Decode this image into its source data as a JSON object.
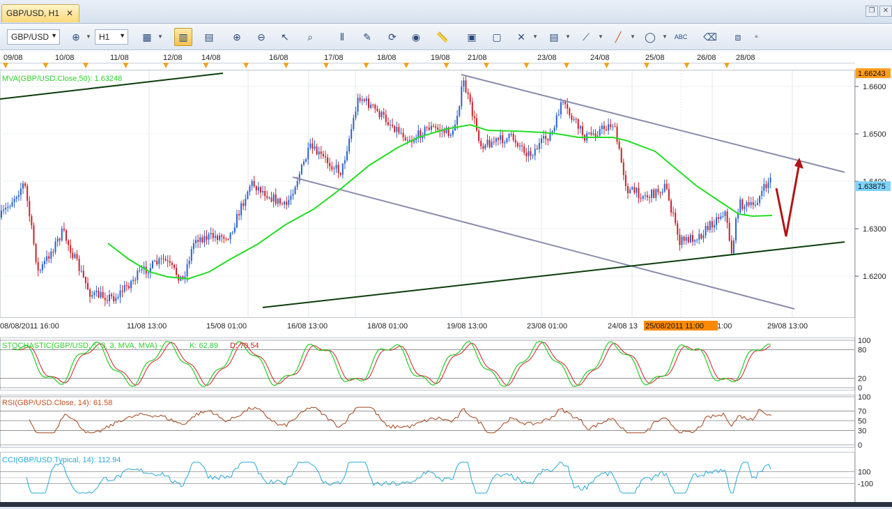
{
  "tab": {
    "title": "GBP/USD, H1",
    "close": "✕"
  },
  "toolbar": {
    "symbol": "GBP/USD",
    "timeframe": "H1",
    "icons": [
      "chart-type-icon",
      "crosshair-icon",
      "candles-icon",
      "bars-icon",
      "zoom-in-icon",
      "zoom-out-icon",
      "cursor-icon",
      "zoom-icon",
      "period-separator-icon",
      "properties-icon",
      "refresh-icon",
      "globe-icon",
      "ruler-icon",
      "picture-icon",
      "template-icon",
      "tools-icon",
      "channel-icon",
      "trendline-icon",
      "pencil-icon",
      "ellipse-icon",
      "text-icon",
      "eraser-icon",
      "objects-icon"
    ]
  },
  "chart": {
    "top_dates": [
      "09/08",
      "10/08",
      "11/08",
      "12/08",
      "14/08",
      "16/08",
      "17/08",
      "18/08",
      "19/08",
      "21/08",
      "23/08",
      "24/08",
      "25/08",
      "26/08",
      "28/08"
    ],
    "bottom_times": [
      "08/08/2011 16:00",
      "11/08 13:00",
      "15/08 01:00",
      "16/08 13:00",
      "18/08 01:00",
      "19/08 13:00",
      "23/08 01:00",
      "24/08 13",
      "1:00",
      "29/08 13:00"
    ],
    "cursor_time": "25/08/2011 11:00",
    "price_labels": [
      "1.6600",
      "1.6500",
      "1.6400",
      "1.6300",
      "1.6200"
    ],
    "top_price": "1.66243",
    "current_price": "1.63875",
    "mva_label": "MVA(GBP/USD.Close,50): 1.63248"
  },
  "stochastic": {
    "label": "STOCHASTIC(GBP/USD, 5, 3, 3, MVA, MVA) -",
    "k": "K: 62.89",
    "d": "D: 70.54",
    "levels": [
      "100",
      "80",
      "20",
      "0"
    ]
  },
  "rsi": {
    "label": "RSI(GBP/USD.Close, 14): 61.58",
    "levels": [
      "100",
      "70",
      "50",
      "30",
      "0"
    ]
  },
  "cci": {
    "label": "CCI(GBP/USD.Typical, 14): 112.94",
    "levels": [
      "100",
      "-100"
    ]
  },
  "colors": {
    "bull": "#2a62c9",
    "bear": "#c8202a",
    "mva": "#22dd22",
    "channel": "#8a8cae",
    "support": "#0a3d0a",
    "arrow": "#b11414"
  }
}
